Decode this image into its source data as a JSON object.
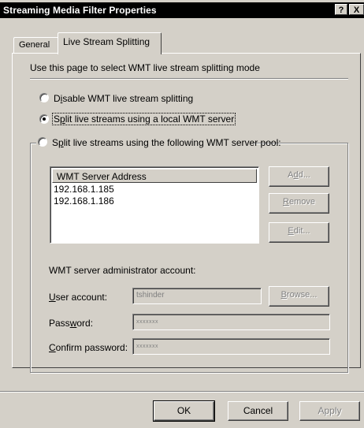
{
  "window": {
    "title": "Streaming Media Filter Properties",
    "help_glyph": "?",
    "close_glyph": "X"
  },
  "tabs": [
    {
      "label": "General"
    },
    {
      "label": "Live Stream Splitting"
    }
  ],
  "intro": "Use this page to select WMT live stream splitting mode",
  "options": {
    "disable": {
      "pre": "D",
      "ul": "i",
      "post": "sable WMT live stream splitting",
      "selected": false
    },
    "local": {
      "pre": "S",
      "ul": "p",
      "post": "lit live streams using a local WMT server",
      "selected": true
    },
    "pool": {
      "pre": "S",
      "ul": "p",
      "post": "lit live streams using the following WMT server pool:",
      "selected": false
    }
  },
  "server_list": {
    "header": "WMT Server Address",
    "rows": [
      "192.168.1.185",
      "192.168.1.186"
    ]
  },
  "list_buttons": {
    "add": {
      "pre": "A",
      "ul": "d",
      "post": "d..."
    },
    "remove": {
      "pre": "",
      "ul": "R",
      "post": "emove"
    },
    "edit": {
      "pre": "",
      "ul": "E",
      "post": "dit..."
    }
  },
  "account": {
    "section_label": "WMT server administrator account:",
    "user_label": {
      "pre": "",
      "ul": "U",
      "post": "ser account:"
    },
    "user_value": "tshinder",
    "browse": {
      "pre": "",
      "ul": "B",
      "post": "rowse..."
    },
    "password_label": {
      "pre": "Pass",
      "ul": "w",
      "post": "ord:"
    },
    "password_value": "xxxxxxx",
    "confirm_label": {
      "pre": "",
      "ul": "C",
      "post": "onfirm password:"
    },
    "confirm_value": "xxxxxxx"
  },
  "footer": {
    "ok": "OK",
    "cancel": "Cancel",
    "apply": "Apply"
  }
}
